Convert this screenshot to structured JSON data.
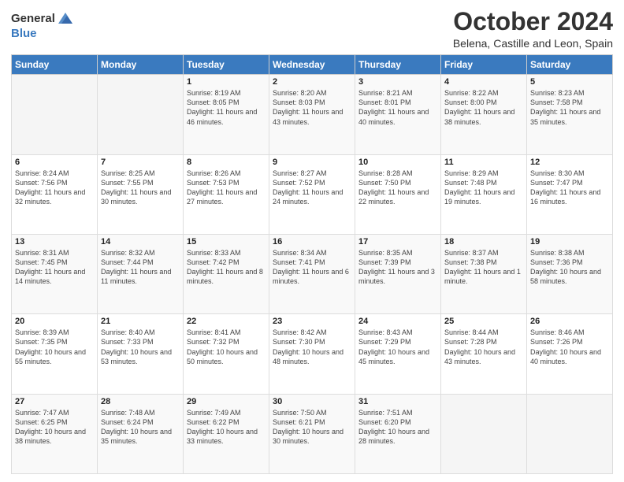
{
  "logo": {
    "text_general": "General",
    "text_blue": "Blue"
  },
  "title": "October 2024",
  "subtitle": "Belena, Castille and Leon, Spain",
  "days_of_week": [
    "Sunday",
    "Monday",
    "Tuesday",
    "Wednesday",
    "Thursday",
    "Friday",
    "Saturday"
  ],
  "weeks": [
    [
      {
        "day": "",
        "info": ""
      },
      {
        "day": "",
        "info": ""
      },
      {
        "day": "1",
        "info": "Sunrise: 8:19 AM\nSunset: 8:05 PM\nDaylight: 11 hours and 46 minutes."
      },
      {
        "day": "2",
        "info": "Sunrise: 8:20 AM\nSunset: 8:03 PM\nDaylight: 11 hours and 43 minutes."
      },
      {
        "day": "3",
        "info": "Sunrise: 8:21 AM\nSunset: 8:01 PM\nDaylight: 11 hours and 40 minutes."
      },
      {
        "day": "4",
        "info": "Sunrise: 8:22 AM\nSunset: 8:00 PM\nDaylight: 11 hours and 38 minutes."
      },
      {
        "day": "5",
        "info": "Sunrise: 8:23 AM\nSunset: 7:58 PM\nDaylight: 11 hours and 35 minutes."
      }
    ],
    [
      {
        "day": "6",
        "info": "Sunrise: 8:24 AM\nSunset: 7:56 PM\nDaylight: 11 hours and 32 minutes."
      },
      {
        "day": "7",
        "info": "Sunrise: 8:25 AM\nSunset: 7:55 PM\nDaylight: 11 hours and 30 minutes."
      },
      {
        "day": "8",
        "info": "Sunrise: 8:26 AM\nSunset: 7:53 PM\nDaylight: 11 hours and 27 minutes."
      },
      {
        "day": "9",
        "info": "Sunrise: 8:27 AM\nSunset: 7:52 PM\nDaylight: 11 hours and 24 minutes."
      },
      {
        "day": "10",
        "info": "Sunrise: 8:28 AM\nSunset: 7:50 PM\nDaylight: 11 hours and 22 minutes."
      },
      {
        "day": "11",
        "info": "Sunrise: 8:29 AM\nSunset: 7:48 PM\nDaylight: 11 hours and 19 minutes."
      },
      {
        "day": "12",
        "info": "Sunrise: 8:30 AM\nSunset: 7:47 PM\nDaylight: 11 hours and 16 minutes."
      }
    ],
    [
      {
        "day": "13",
        "info": "Sunrise: 8:31 AM\nSunset: 7:45 PM\nDaylight: 11 hours and 14 minutes."
      },
      {
        "day": "14",
        "info": "Sunrise: 8:32 AM\nSunset: 7:44 PM\nDaylight: 11 hours and 11 minutes."
      },
      {
        "day": "15",
        "info": "Sunrise: 8:33 AM\nSunset: 7:42 PM\nDaylight: 11 hours and 8 minutes."
      },
      {
        "day": "16",
        "info": "Sunrise: 8:34 AM\nSunset: 7:41 PM\nDaylight: 11 hours and 6 minutes."
      },
      {
        "day": "17",
        "info": "Sunrise: 8:35 AM\nSunset: 7:39 PM\nDaylight: 11 hours and 3 minutes."
      },
      {
        "day": "18",
        "info": "Sunrise: 8:37 AM\nSunset: 7:38 PM\nDaylight: 11 hours and 1 minute."
      },
      {
        "day": "19",
        "info": "Sunrise: 8:38 AM\nSunset: 7:36 PM\nDaylight: 10 hours and 58 minutes."
      }
    ],
    [
      {
        "day": "20",
        "info": "Sunrise: 8:39 AM\nSunset: 7:35 PM\nDaylight: 10 hours and 55 minutes."
      },
      {
        "day": "21",
        "info": "Sunrise: 8:40 AM\nSunset: 7:33 PM\nDaylight: 10 hours and 53 minutes."
      },
      {
        "day": "22",
        "info": "Sunrise: 8:41 AM\nSunset: 7:32 PM\nDaylight: 10 hours and 50 minutes."
      },
      {
        "day": "23",
        "info": "Sunrise: 8:42 AM\nSunset: 7:30 PM\nDaylight: 10 hours and 48 minutes."
      },
      {
        "day": "24",
        "info": "Sunrise: 8:43 AM\nSunset: 7:29 PM\nDaylight: 10 hours and 45 minutes."
      },
      {
        "day": "25",
        "info": "Sunrise: 8:44 AM\nSunset: 7:28 PM\nDaylight: 10 hours and 43 minutes."
      },
      {
        "day": "26",
        "info": "Sunrise: 8:46 AM\nSunset: 7:26 PM\nDaylight: 10 hours and 40 minutes."
      }
    ],
    [
      {
        "day": "27",
        "info": "Sunrise: 7:47 AM\nSunset: 6:25 PM\nDaylight: 10 hours and 38 minutes."
      },
      {
        "day": "28",
        "info": "Sunrise: 7:48 AM\nSunset: 6:24 PM\nDaylight: 10 hours and 35 minutes."
      },
      {
        "day": "29",
        "info": "Sunrise: 7:49 AM\nSunset: 6:22 PM\nDaylight: 10 hours and 33 minutes."
      },
      {
        "day": "30",
        "info": "Sunrise: 7:50 AM\nSunset: 6:21 PM\nDaylight: 10 hours and 30 minutes."
      },
      {
        "day": "31",
        "info": "Sunrise: 7:51 AM\nSunset: 6:20 PM\nDaylight: 10 hours and 28 minutes."
      },
      {
        "day": "",
        "info": ""
      },
      {
        "day": "",
        "info": ""
      }
    ]
  ]
}
